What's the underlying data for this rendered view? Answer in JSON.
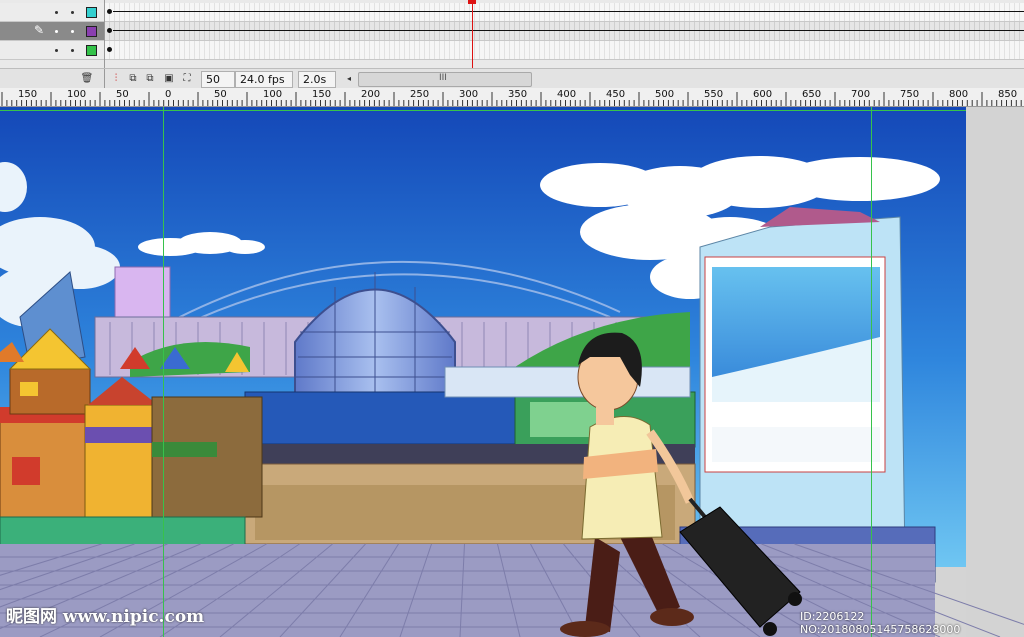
{
  "timeline": {
    "layers": [
      {
        "color": "#34d0d0",
        "selected": false
      },
      {
        "color": "#8a3fb0",
        "selected": true
      },
      {
        "color": "#34c24a",
        "selected": false
      }
    ],
    "frame_field": "50",
    "fps_field": "24.0 fps",
    "time_field": "2.0s",
    "scroll_grip": "III"
  },
  "ruler": {
    "labels": [
      "150",
      "100",
      "50",
      "0",
      "50",
      "100",
      "150",
      "200",
      "250",
      "300",
      "350",
      "400",
      "450",
      "500",
      "550",
      "600",
      "650",
      "700",
      "750",
      "800",
      "850"
    ]
  },
  "watermark": {
    "left": "昵图网 www.nipic.com",
    "right": "ID:2206122 NO:20180805145758628000"
  },
  "colors": {
    "sky_top": "#1448b8",
    "sky_bottom": "#52b7ee",
    "guide": "#37c24b",
    "playhead": "#dd1111"
  }
}
